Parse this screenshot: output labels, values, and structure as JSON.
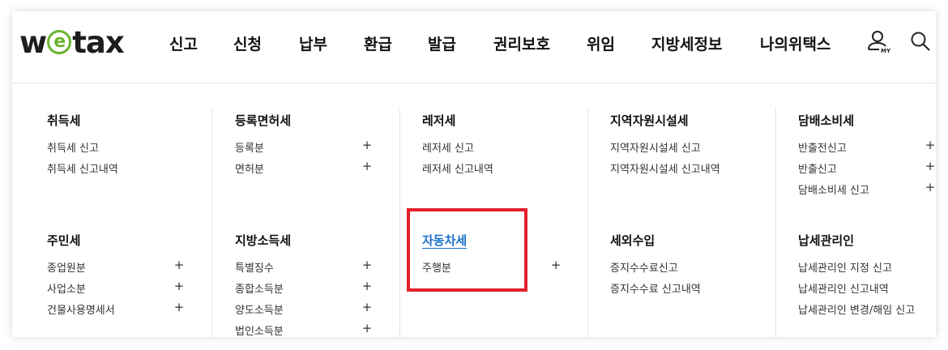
{
  "brand": {
    "logo_left": "w",
    "logo_e": "e",
    "logo_right": "tax",
    "accent_color": "#6ab42d"
  },
  "nav": [
    {
      "label": "신고"
    },
    {
      "label": "신청"
    },
    {
      "label": "납부"
    },
    {
      "label": "환급"
    },
    {
      "label": "발급"
    },
    {
      "label": "권리보호"
    },
    {
      "label": "위임"
    },
    {
      "label": "지방세정보"
    },
    {
      "label": "나의위택스"
    }
  ],
  "util": {
    "my_label": "MY",
    "my_icon": "user-icon",
    "search_icon": "search-icon"
  },
  "expand_symbol": "+",
  "groups": [
    {
      "title": "취득세",
      "items": [
        {
          "label": "취득세 신고"
        },
        {
          "label": "취득세 신고내역"
        }
      ]
    },
    {
      "title": "등록면허세",
      "items": [
        {
          "label": "등록분",
          "expand": true
        },
        {
          "label": "면허분",
          "expand": true
        }
      ]
    },
    {
      "title": "레저세",
      "items": [
        {
          "label": "레저세 신고"
        },
        {
          "label": "레저세 신고내역"
        }
      ]
    },
    {
      "title": "지역자원시설세",
      "items": [
        {
          "label": "지역자원시설세 신고"
        },
        {
          "label": "지역자원시설세 신고내역"
        }
      ]
    },
    {
      "title": "담배소비세",
      "items": [
        {
          "label": "반출전신고",
          "expand": true
        },
        {
          "label": "반출신고",
          "expand": true
        },
        {
          "label": "담배소비세 신고",
          "expand": true
        }
      ]
    },
    {
      "title": "주민세",
      "items": [
        {
          "label": "종업원분",
          "expand": true
        },
        {
          "label": "사업소분",
          "expand": true
        },
        {
          "label": "건물사용명세서",
          "expand": true
        }
      ]
    },
    {
      "title": "지방소득세",
      "items": [
        {
          "label": "특별징수",
          "expand": true
        },
        {
          "label": "종합소득분",
          "expand": true
        },
        {
          "label": "양도소득분",
          "expand": true
        },
        {
          "label": "법인소득분",
          "expand": true
        }
      ]
    },
    {
      "title": "자동차세",
      "active": true,
      "highlight_color": "#e3202c",
      "items": [
        {
          "label": "주행분",
          "expand": true
        }
      ]
    },
    {
      "title": "세외수입",
      "items": [
        {
          "label": "증지수수료신고"
        },
        {
          "label": "증지수수료 신고내역"
        }
      ]
    },
    {
      "title": "납세관리인",
      "items": [
        {
          "label": "납세관리인 지정 신고"
        },
        {
          "label": "납세관리인 신고내역"
        },
        {
          "label": "납세관리인 변경/해임 신고"
        }
      ]
    }
  ]
}
